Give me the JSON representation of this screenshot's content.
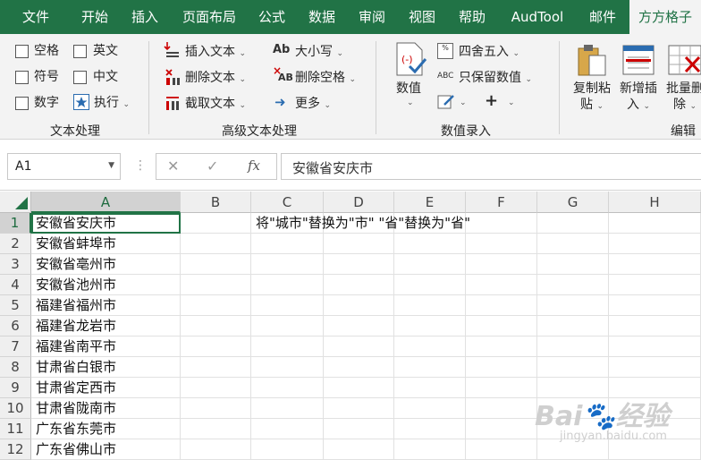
{
  "tabs": [
    {
      "label": "文件"
    },
    {
      "label": "开始"
    },
    {
      "label": "插入"
    },
    {
      "label": "页面布局"
    },
    {
      "label": "公式"
    },
    {
      "label": "数据"
    },
    {
      "label": "审阅"
    },
    {
      "label": "视图"
    },
    {
      "label": "帮助"
    },
    {
      "label": "AudTool"
    },
    {
      "label": "邮件"
    },
    {
      "label": "方方格子"
    }
  ],
  "ribbon": {
    "text_group": {
      "space": "空格",
      "english": "英文",
      "symbol": "符号",
      "chinese": "中文",
      "number": "数字",
      "execute": "执行",
      "label": "文本处理"
    },
    "adv_group": {
      "insert_text": "插入文本",
      "delete_text": "删除文本",
      "extract_text": "截取文本",
      "case": "大小写",
      "delete_space": "删除空格",
      "more": "更多",
      "label": "高级文本处理"
    },
    "num_group": {
      "value": "数值",
      "round": "四舍五入",
      "keep_value": "只保留数值",
      "label": "数值录入",
      "plus": "+"
    },
    "edit_group": {
      "copy_paste_1": "复制粘",
      "copy_paste_2": "贴",
      "add_insert_1": "新增插",
      "add_insert_2": "入",
      "batch_del_1": "批量删",
      "batch_del_2": "除",
      "label": "编辑"
    }
  },
  "formula_bar": {
    "name_box": "A1",
    "cancel": "✕",
    "enter": "✓",
    "fx": "fx",
    "formula": "安徽省安庆市"
  },
  "grid": {
    "columns": [
      "A",
      "B",
      "C",
      "D",
      "E",
      "F",
      "G",
      "H"
    ],
    "rows": [
      "1",
      "2",
      "3",
      "4",
      "5",
      "6",
      "7",
      "8",
      "9",
      "10",
      "11",
      "12"
    ],
    "col_a": [
      "安徽省安庆市",
      "安徽省蚌埠市",
      "安徽省亳州市",
      "安徽省池州市",
      "福建省福州市",
      "福建省龙岩市",
      "福建省南平市",
      "甘肃省白银市",
      "甘肃省定西市",
      "甘肃省陇南市",
      "广东省东莞市",
      "广东省佛山市"
    ],
    "c1": "将\"城市\"替换为\"市\"  \"省\"替换为\"省\""
  },
  "watermark": {
    "brand": "Bai",
    "brand2": "经验",
    "url": "jingyan.baidu.com"
  }
}
